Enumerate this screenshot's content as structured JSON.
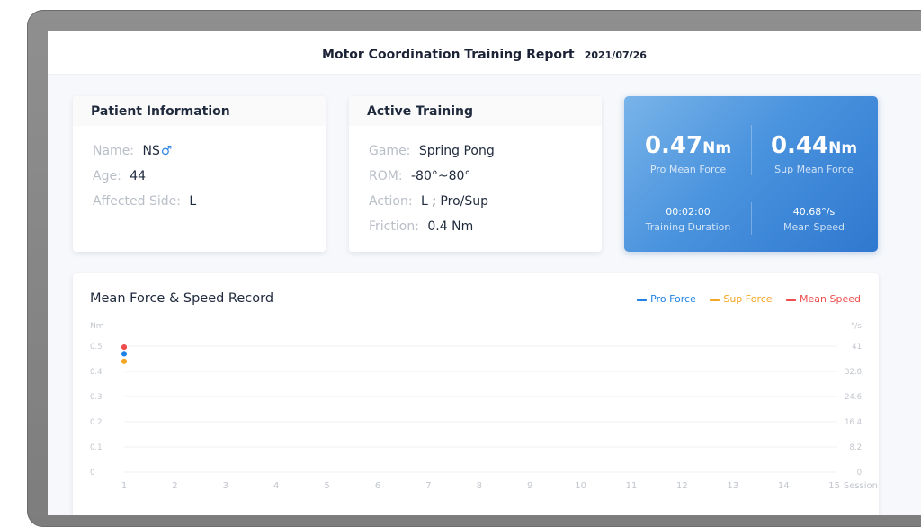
{
  "header": {
    "title": "Motor Coordination Training Report",
    "date": "2021/07/26"
  },
  "patient": {
    "heading": "Patient Information",
    "name_label": "Name:",
    "name_value": "NS",
    "gender_icon": "male-icon",
    "age_label": "Age:",
    "age_value": "44",
    "side_label": "Affected Side:",
    "side_value": "L"
  },
  "training": {
    "heading": "Active Training",
    "game_label": "Game:",
    "game_value": "Spring Pong",
    "rom_label": "ROM:",
    "rom_value": "-80°~80°",
    "action_label": "Action:",
    "action_value": "L ; Pro/Sup",
    "friction_label": "Friction:",
    "friction_value": "0.4 Nm"
  },
  "stats": {
    "pro_force_value": "0.47",
    "pro_force_unit": "Nm",
    "pro_force_label": "Pro Mean Force",
    "sup_force_value": "0.44",
    "sup_force_unit": "Nm",
    "sup_force_label": "Sup Mean Force",
    "duration_value": "00:02:00",
    "duration_label": "Training Duration",
    "speed_value": "40.68°/s",
    "speed_label": "Mean Speed"
  },
  "colors": {
    "pro": "#1e82e6",
    "sup": "#f5a623",
    "speed": "#ef4d4d"
  },
  "chart_data": {
    "type": "line",
    "title": "Mean Force & Speed Record",
    "x_label": "Session",
    "y_left_label": "Nm",
    "y_right_label": "°/s",
    "x": [
      1,
      2,
      3,
      4,
      5,
      6,
      7,
      8,
      9,
      10,
      11,
      12,
      13,
      14,
      15
    ],
    "y_left_ticks": [
      "0",
      "0.1",
      "0.2",
      "0.3",
      "0.4",
      "0.5"
    ],
    "y_right_ticks": [
      "0",
      "8.2",
      "16.4",
      "24.6",
      "32.8",
      "41"
    ],
    "y_left_range": [
      0,
      0.5
    ],
    "y_right_range": [
      0,
      41
    ],
    "series": [
      {
        "name": "Pro Force",
        "axis": "left",
        "color": "#1e82e6",
        "values": [
          0.47
        ]
      },
      {
        "name": "Sup Force",
        "axis": "left",
        "color": "#f5a623",
        "values": [
          0.44
        ]
      },
      {
        "name": "Mean Speed",
        "axis": "right",
        "color": "#ef4d4d",
        "values": [
          40.68
        ]
      }
    ]
  }
}
